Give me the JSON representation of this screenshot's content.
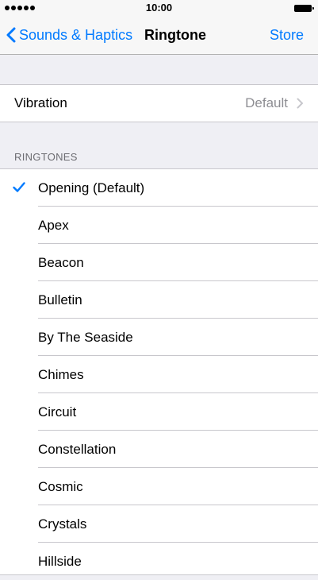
{
  "status_bar": {
    "time": "10:00"
  },
  "nav": {
    "back_label": "Sounds & Haptics",
    "title": "Ringtone",
    "store_label": "Store"
  },
  "vibration": {
    "label": "Vibration",
    "value": "Default"
  },
  "ringtones": {
    "header": "RINGTONES",
    "selected_index": 0,
    "items": [
      "Opening (Default)",
      "Apex",
      "Beacon",
      "Bulletin",
      "By The Seaside",
      "Chimes",
      "Circuit",
      "Constellation",
      "Cosmic",
      "Crystals",
      "Hillside"
    ]
  },
  "colors": {
    "accent": "#007aff",
    "background": "#efeff4",
    "secondary_text": "#8e8e93"
  },
  "icons": {
    "back": "chevron-left-icon",
    "disclosure": "chevron-right-icon",
    "selected": "checkmark-icon",
    "signal": "signal-dots-icon",
    "battery": "battery-icon"
  }
}
